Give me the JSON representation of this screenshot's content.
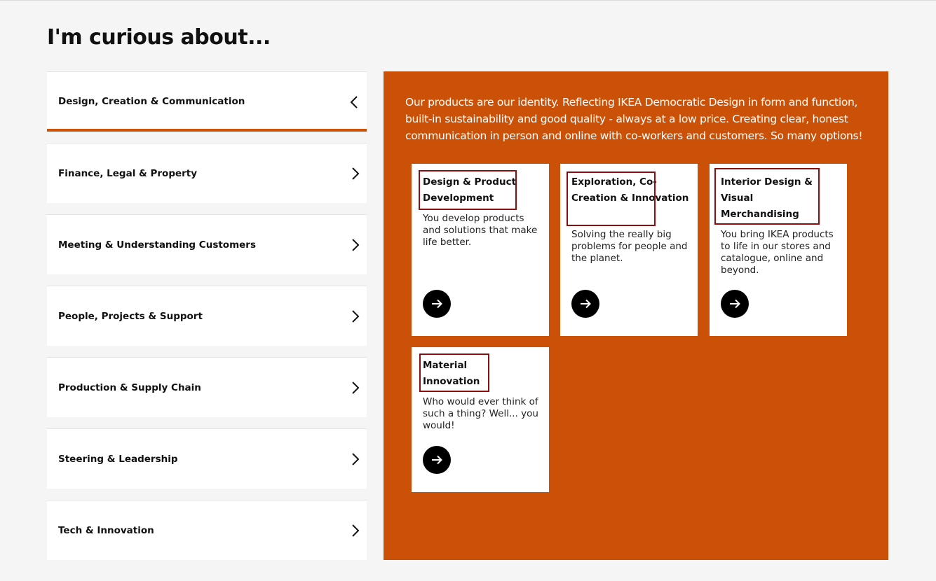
{
  "page": {
    "title": "I'm curious about..."
  },
  "accordion": {
    "items": [
      {
        "label": "Design, Creation & Communication",
        "state": "expanded",
        "icon": "chevron-left-icon"
      },
      {
        "label": "Finance, Legal & Property",
        "state": "collapsed",
        "icon": "chevron-right-icon"
      },
      {
        "label": "Meeting & Understanding Customers",
        "state": "collapsed",
        "icon": "chevron-right-icon"
      },
      {
        "label": "People, Projects & Support",
        "state": "collapsed",
        "icon": "chevron-right-icon"
      },
      {
        "label": "Production & Supply Chain",
        "state": "collapsed",
        "icon": "chevron-right-icon"
      },
      {
        "label": "Steering & Leadership",
        "state": "collapsed",
        "icon": "chevron-right-icon"
      },
      {
        "label": "Tech & Innovation",
        "state": "collapsed",
        "icon": "chevron-right-icon"
      }
    ]
  },
  "panel": {
    "intro": "Our products are our identity. Reflecting IKEA Democratic Design in form and function, built-in sustainability and good quality - always at a low price. Creating clear, honest communication in person and online with co-workers and customers. So many options!",
    "cards": [
      {
        "title": "Design & Product Development",
        "description": "You develop products and solutions that make life better.",
        "arrow_icon": "arrow-right-icon"
      },
      {
        "title": "Exploration, Co-Creation & Innovation",
        "description": "Solving the really big problems for people and the planet.",
        "arrow_icon": "arrow-right-icon"
      },
      {
        "title": "Interior Design & Visual Merchandising",
        "description": "You bring IKEA products to life in our stores and catalogue, online and beyond.",
        "arrow_icon": "arrow-right-icon"
      },
      {
        "title": "Material Innovation",
        "description": "Who would ever think of such a thing? Well... you would!",
        "arrow_icon": "arrow-right-icon"
      }
    ]
  },
  "colors": {
    "accent": "#cc5108",
    "page_background": "#f5f5f5",
    "card_background": "#ffffff",
    "highlight_box": "#8b0f0f",
    "arrow_button": "#000000"
  }
}
